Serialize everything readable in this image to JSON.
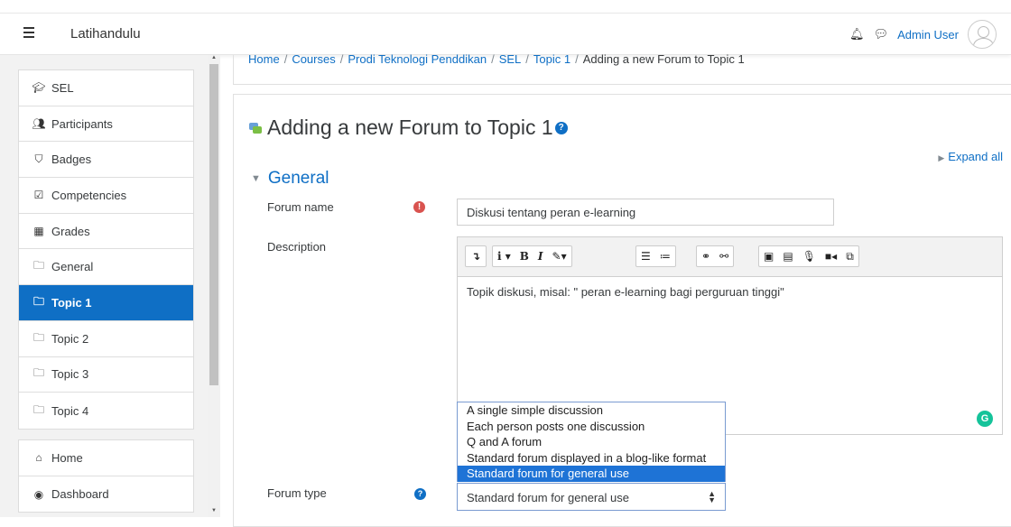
{
  "navbar": {
    "brand": "Latihandulu",
    "user_name": "Admin User"
  },
  "sidebar": {
    "course_items": [
      {
        "label": "SEL",
        "icon": "graduation-cap-icon",
        "glyph": "🎓︎"
      },
      {
        "label": "Participants",
        "icon": "users-icon",
        "glyph": "👥︎"
      },
      {
        "label": "Badges",
        "icon": "shield-icon",
        "glyph": "⛉"
      },
      {
        "label": "Competencies",
        "icon": "check-square-icon",
        "glyph": "☑"
      },
      {
        "label": "Grades",
        "icon": "table-icon",
        "glyph": "▦"
      },
      {
        "label": "General",
        "icon": "folder-icon",
        "glyph": "🗀"
      },
      {
        "label": "Topic 1",
        "icon": "folder-icon",
        "glyph": "🗀",
        "active": true
      },
      {
        "label": "Topic 2",
        "icon": "folder-icon",
        "glyph": "🗀"
      },
      {
        "label": "Topic 3",
        "icon": "folder-icon",
        "glyph": "🗀"
      },
      {
        "label": "Topic 4",
        "icon": "folder-icon",
        "glyph": "🗀"
      }
    ],
    "site_items": [
      {
        "label": "Home",
        "icon": "home-icon",
        "glyph": "⌂"
      },
      {
        "label": "Dashboard",
        "icon": "dashboard-icon",
        "glyph": "◉"
      }
    ]
  },
  "breadcrumb": [
    "Home",
    "Courses",
    "Prodi Teknologi Penddikan",
    "SEL",
    "Topic 1",
    "Adding a new Forum to Topic 1"
  ],
  "page": {
    "title": "Adding a new Forum to Topic 1",
    "expand_all": "Expand all",
    "section_title": "General"
  },
  "form": {
    "forum_name_label": "Forum name",
    "forum_name_value": "Diskusi tentang peran e-learning",
    "description_label": "Description",
    "description_value": "Topik diskusi, misal: \" peran e-learning bagi perguruan tinggi\"",
    "forum_type_label": "Forum type",
    "forum_type_value": "Standard forum for general use",
    "forum_type_options": [
      "A single simple discussion",
      "Each person posts one discussion",
      "Q and A forum",
      "Standard forum displayed in a blog-like format",
      "Standard forum for general use"
    ]
  },
  "colors": {
    "accent": "#0f6fc5",
    "active_option": "#1e73d6",
    "required": "#d9534f",
    "grammarly": "#15c39a"
  }
}
